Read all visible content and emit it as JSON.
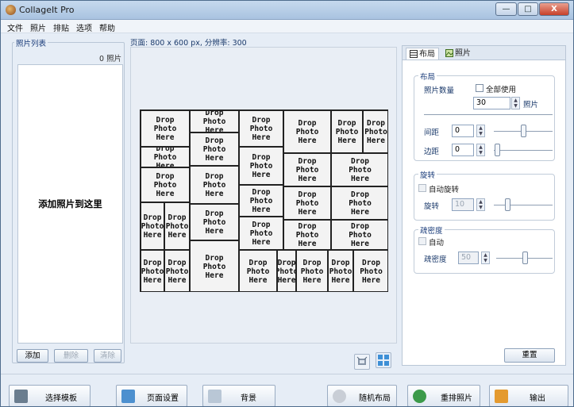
{
  "window": {
    "title": "CollageIt Pro",
    "minimize": "—",
    "maximize": "□",
    "close": "X"
  },
  "menu": [
    "文件",
    "照片",
    "排贴",
    "选项",
    "帮助"
  ],
  "left": {
    "group_label": "照片列表",
    "photo_count": "0 照片",
    "drop_text": "添加照片到这里",
    "add_button": "添加",
    "delete_button": "删除",
    "clear_button": "清除"
  },
  "page_info": "页面: 800 x 600 px, 分辨率: 300",
  "collage_label": {
    "l1": "Drop",
    "l2": "Photo",
    "l3": "Here"
  },
  "right": {
    "tab_layout": "布局",
    "tab_photo": "照片",
    "layout": {
      "group": "布局",
      "photo_count_label": "照片数量",
      "use_all_label": "全部使用",
      "photo_count_value": "30",
      "photo_unit": "照片",
      "spacing_label": "间距",
      "spacing_value": "0",
      "margin_label": "边距",
      "margin_value": "0"
    },
    "rotation": {
      "group": "旋转",
      "auto_label": "自动旋转",
      "value_label": "旋转",
      "value": "10"
    },
    "density": {
      "group": "疏密度",
      "auto_label": "自动",
      "value_label": "疏密度",
      "value": "50"
    },
    "reset_button": "重置"
  },
  "bottom": {
    "select_template": "选择模板",
    "page_setup": "页面设置",
    "background": "背景",
    "random_layout": "随机布局",
    "shuffle": "重排照片",
    "export": "输出"
  }
}
